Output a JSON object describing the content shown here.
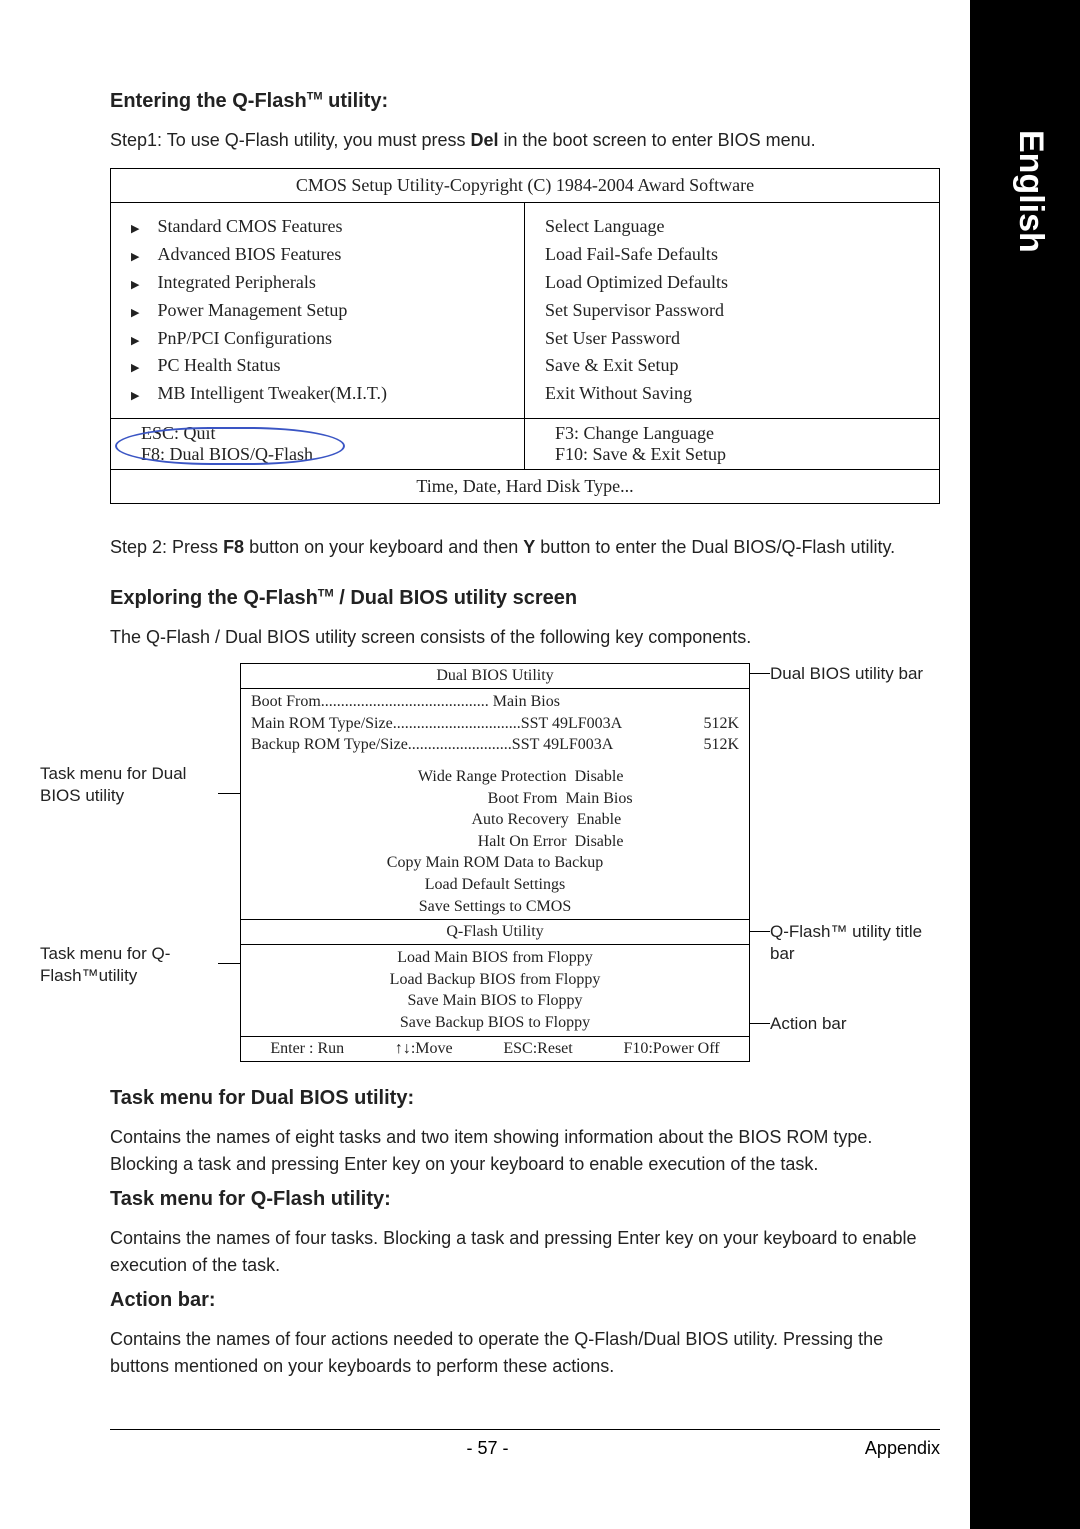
{
  "side_label": "English",
  "section1": {
    "heading_prefix": "Entering the Q-Flash",
    "heading_suffix": " utility:",
    "step1_prefix": "Step1: To use Q-Flash utility, you must press ",
    "step1_key": "Del",
    "step1_suffix": " in the boot screen to enter BIOS menu."
  },
  "bios": {
    "title": "CMOS Setup Utility-Copyright (C) 1984-2004 Award Software",
    "left_items": [
      "Standard CMOS Features",
      "Advanced BIOS Features",
      "Integrated Peripherals",
      "Power Management Setup",
      "PnP/PCI Configurations",
      "PC Health Status",
      "MB Intelligent Tweaker(M.I.T.)"
    ],
    "right_items": [
      "Select Language",
      "Load Fail-Safe Defaults",
      "Load Optimized Defaults",
      "Set Supervisor Password",
      "Set User Password",
      "Save & Exit Setup",
      "Exit Without Saving"
    ],
    "keys_left1": "ESC: Quit",
    "keys_left2": "F8: Dual BIOS/Q-Flash",
    "keys_right1": "F3: Change Language",
    "keys_right2": "F10: Save & Exit Setup",
    "footer": "Time, Date, Hard Disk Type..."
  },
  "step2": {
    "prefix": "Step 2: Press ",
    "key1": "F8",
    "mid": " button on your keyboard and then ",
    "key2": "Y",
    "suffix": " button to enter the Dual BIOS/Q-Flash utility."
  },
  "section2": {
    "heading_prefix": "Exploring the Q-Flash",
    "heading_suffix": " / Dual BIOS utility screen",
    "intro": "The Q-Flash / Dual BIOS utility screen consists of the following key components."
  },
  "qflash": {
    "title1": "Dual BIOS Utility",
    "boot_from_label": "Boot From..........................................",
    "boot_from_value": "Main Bios",
    "rom1_label": "Main ROM Type/Size................................",
    "rom1_value": "SST 49LF003A",
    "rom1_size": "512K",
    "rom2_label": "Backup ROM Type/Size..........................",
    "rom2_value": "SST 49LF003A",
    "rom2_size": "512K",
    "settings": [
      [
        "Wide Range Protection",
        "Disable"
      ],
      [
        "Boot From",
        "Main Bios"
      ],
      [
        "Auto Recovery",
        "Enable"
      ],
      [
        "Halt On Error",
        "Disable"
      ]
    ],
    "tasks_dual": [
      "Copy Main ROM Data to Backup",
      "Load Default Settings",
      "Save Settings to CMOS"
    ],
    "title2": "Q-Flash Utility",
    "tasks_qflash": [
      "Load Main BIOS from Floppy",
      "Load Backup BIOS from Floppy",
      "Save Main BIOS to Floppy",
      "Save Backup BIOS to Floppy"
    ],
    "actions": [
      "Enter : Run",
      "↑↓:Move",
      "ESC:Reset",
      "F10:Power Off"
    ]
  },
  "annotations": {
    "dual_bar": "Dual BIOS utility bar",
    "task_dual": "Task menu for Dual BIOS utility",
    "qflash_title": "Q-Flash™ utility title bar",
    "task_qflash": "Task menu for Q-Flash™utility",
    "action_bar": "Action bar"
  },
  "section3": {
    "h1": "Task menu for Dual BIOS utility:",
    "p1": "Contains the names of eight tasks and two item showing information about the BIOS ROM type. Blocking a task and pressing Enter key on your keyboard to enable execution of the task.",
    "h2": "Task menu for Q-Flash utility:",
    "p2": "Contains the names of four tasks. Blocking a task and pressing Enter key on your keyboard to enable execution of the task.",
    "h3": "Action bar:",
    "p3": "Contains the names of four actions needed to operate the Q-Flash/Dual BIOS utility. Pressing the buttons mentioned on your keyboards to perform these actions."
  },
  "footer": {
    "page": "- 57 -",
    "section": "Appendix"
  }
}
